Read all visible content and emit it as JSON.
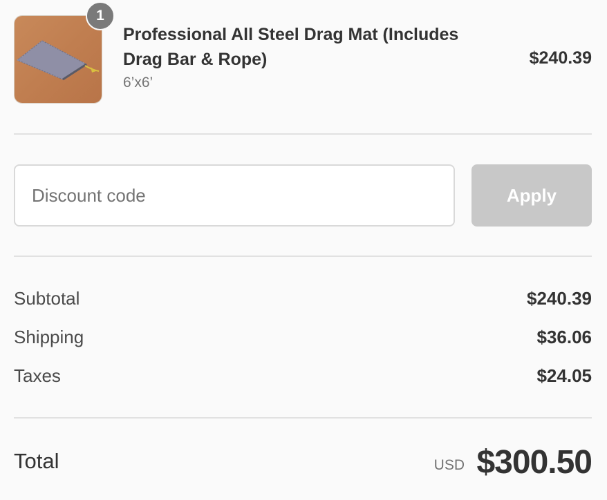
{
  "product": {
    "quantity": "1",
    "title": "Professional All Steel Drag Mat (Includes Drag Bar & Rope)",
    "variant": "6’x6’",
    "price": "$240.39",
    "image_icon": "drag-mat-product-image"
  },
  "discount": {
    "placeholder": "Discount code",
    "value": "",
    "apply_label": "Apply"
  },
  "summary": {
    "subtotal_label": "Subtotal",
    "subtotal_value": "$240.39",
    "shipping_label": "Shipping",
    "shipping_value": "$36.06",
    "taxes_label": "Taxes",
    "taxes_value": "$24.05"
  },
  "total": {
    "label": "Total",
    "currency": "USD",
    "amount": "$300.50"
  },
  "colors": {
    "background": "#fafafa",
    "text": "#333333",
    "muted": "#737373",
    "apply_disabled": "#c8c8c8",
    "badge": "#7a7a7a"
  }
}
